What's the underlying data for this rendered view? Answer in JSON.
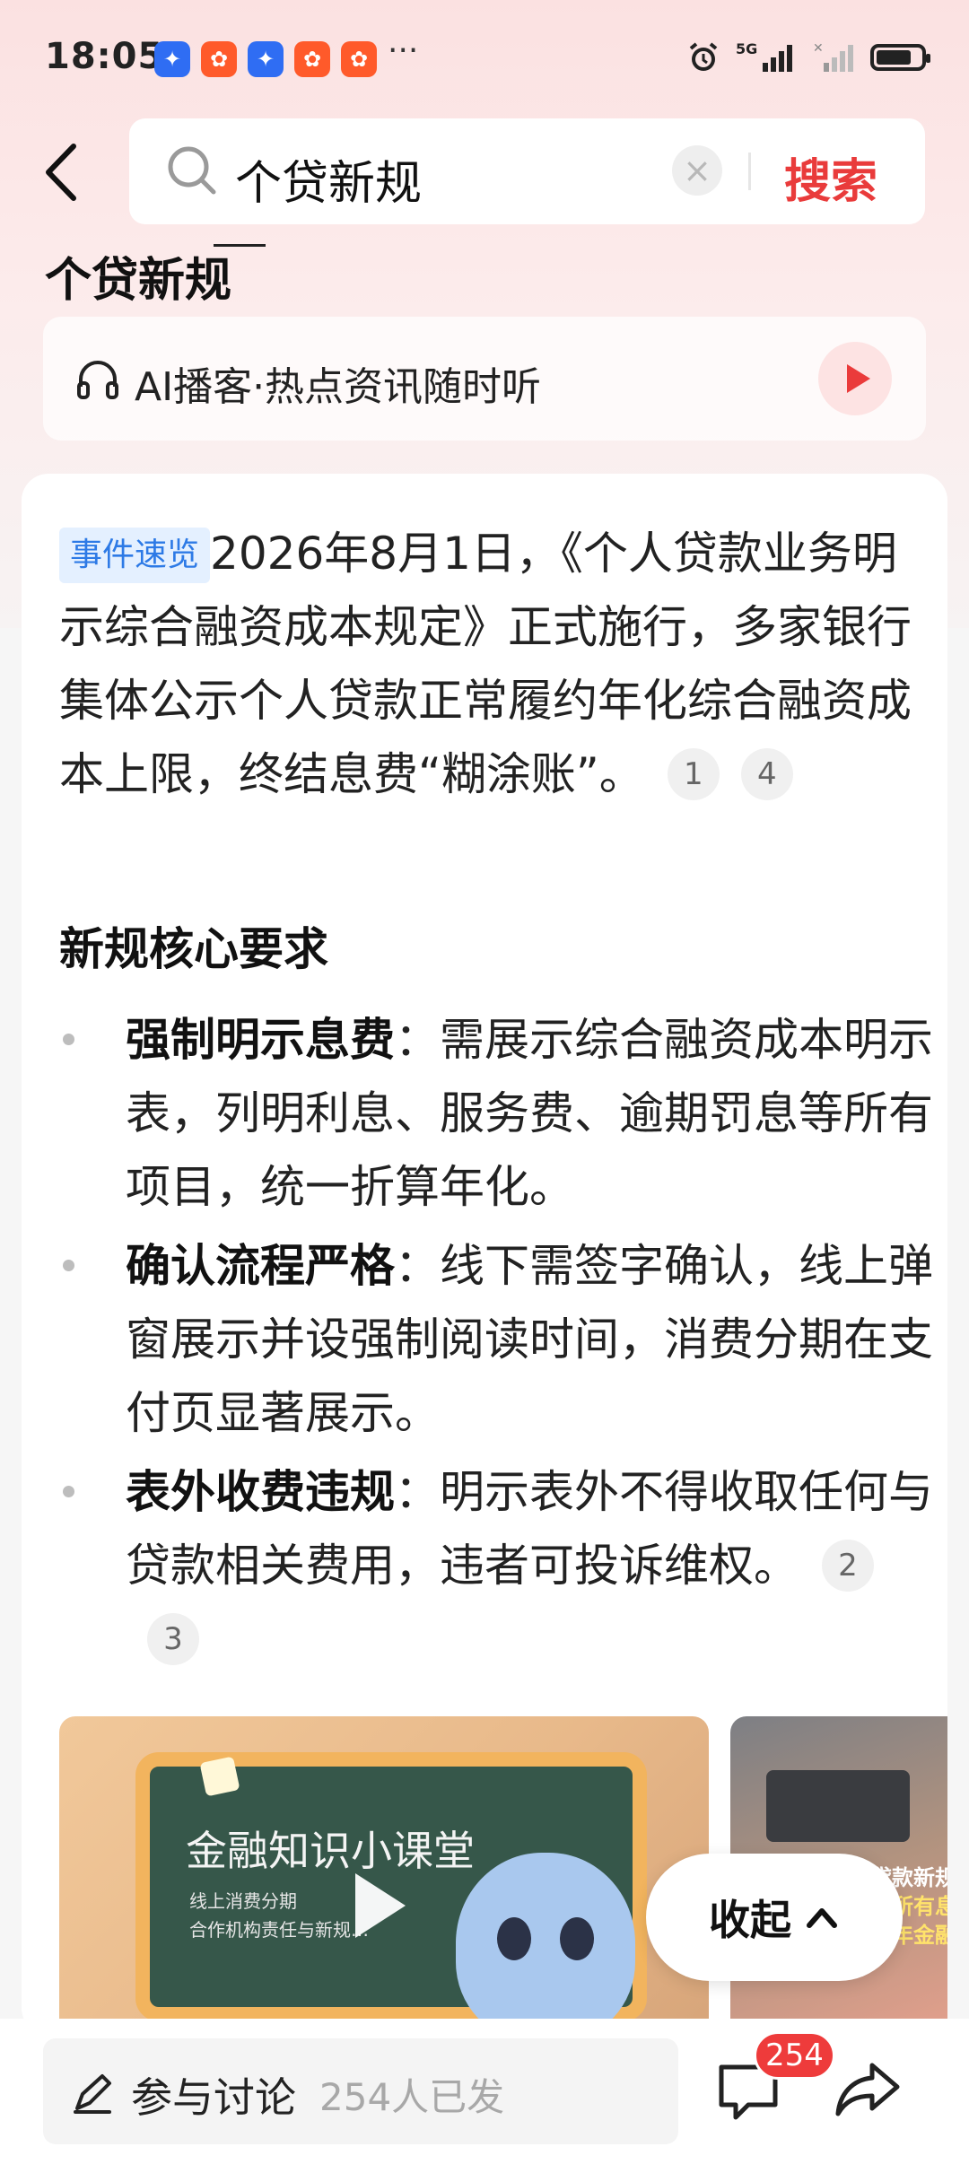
{
  "status_bar": {
    "time": "18:05",
    "app_icons": [
      "app-blue-icon",
      "app-orange-icon",
      "app-blue-icon",
      "app-orange-icon",
      "app-orange-icon"
    ],
    "more": "···",
    "network": "5G",
    "battery_level": 0.8
  },
  "search": {
    "query": "个贷新规",
    "clear_icon": "close-icon",
    "button_label": "搜索"
  },
  "page_title": "个贷新规",
  "ai_podcast": {
    "label": "AI播客·热点资讯随时听"
  },
  "event": {
    "tag": "事件速览",
    "text": "2026年8月1日，《个人贷款业务明示综合融资成本规定》正式施行，多家银行集体公示个人贷款正常履约年化综合融资成本上限，终结息费“糊涂账”。",
    "citations": [
      "1",
      "4"
    ]
  },
  "section": {
    "heading": "新规核心要求",
    "items": [
      {
        "title": "强制明示息费",
        "sep": "：",
        "text": "需展示综合融资成本明示表，列明利息、服务费、逾期罚息等所有项目，统一折算年化。",
        "citations": []
      },
      {
        "title": "确认流程严格",
        "sep": "：",
        "text": "线下需签字确认，线上弹窗展示并设强制阅读时间，消费分期在支付页显著展示。",
        "citations": []
      },
      {
        "title": "表外收费违规",
        "sep": "：",
        "text": "明示表外不得收取任何与贷款相关费用，违者可投诉维权。",
        "citations": [
          "2",
          "3"
        ]
      }
    ]
  },
  "media": {
    "video1": {
      "title": "金融知识小课堂",
      "sub1": "线上消费分期",
      "sub2": "合作机构责任与新规…"
    },
    "video2": {
      "cap1": "贷款新规",
      "cap2": "所有息",
      "cap3": "年金融"
    }
  },
  "collapse": {
    "label": "收起",
    "icon": "chevron-up-icon"
  },
  "bottom_bar": {
    "discuss_label": "参与讨论",
    "discuss_count": "254人已发",
    "comment_badge": "254"
  }
}
